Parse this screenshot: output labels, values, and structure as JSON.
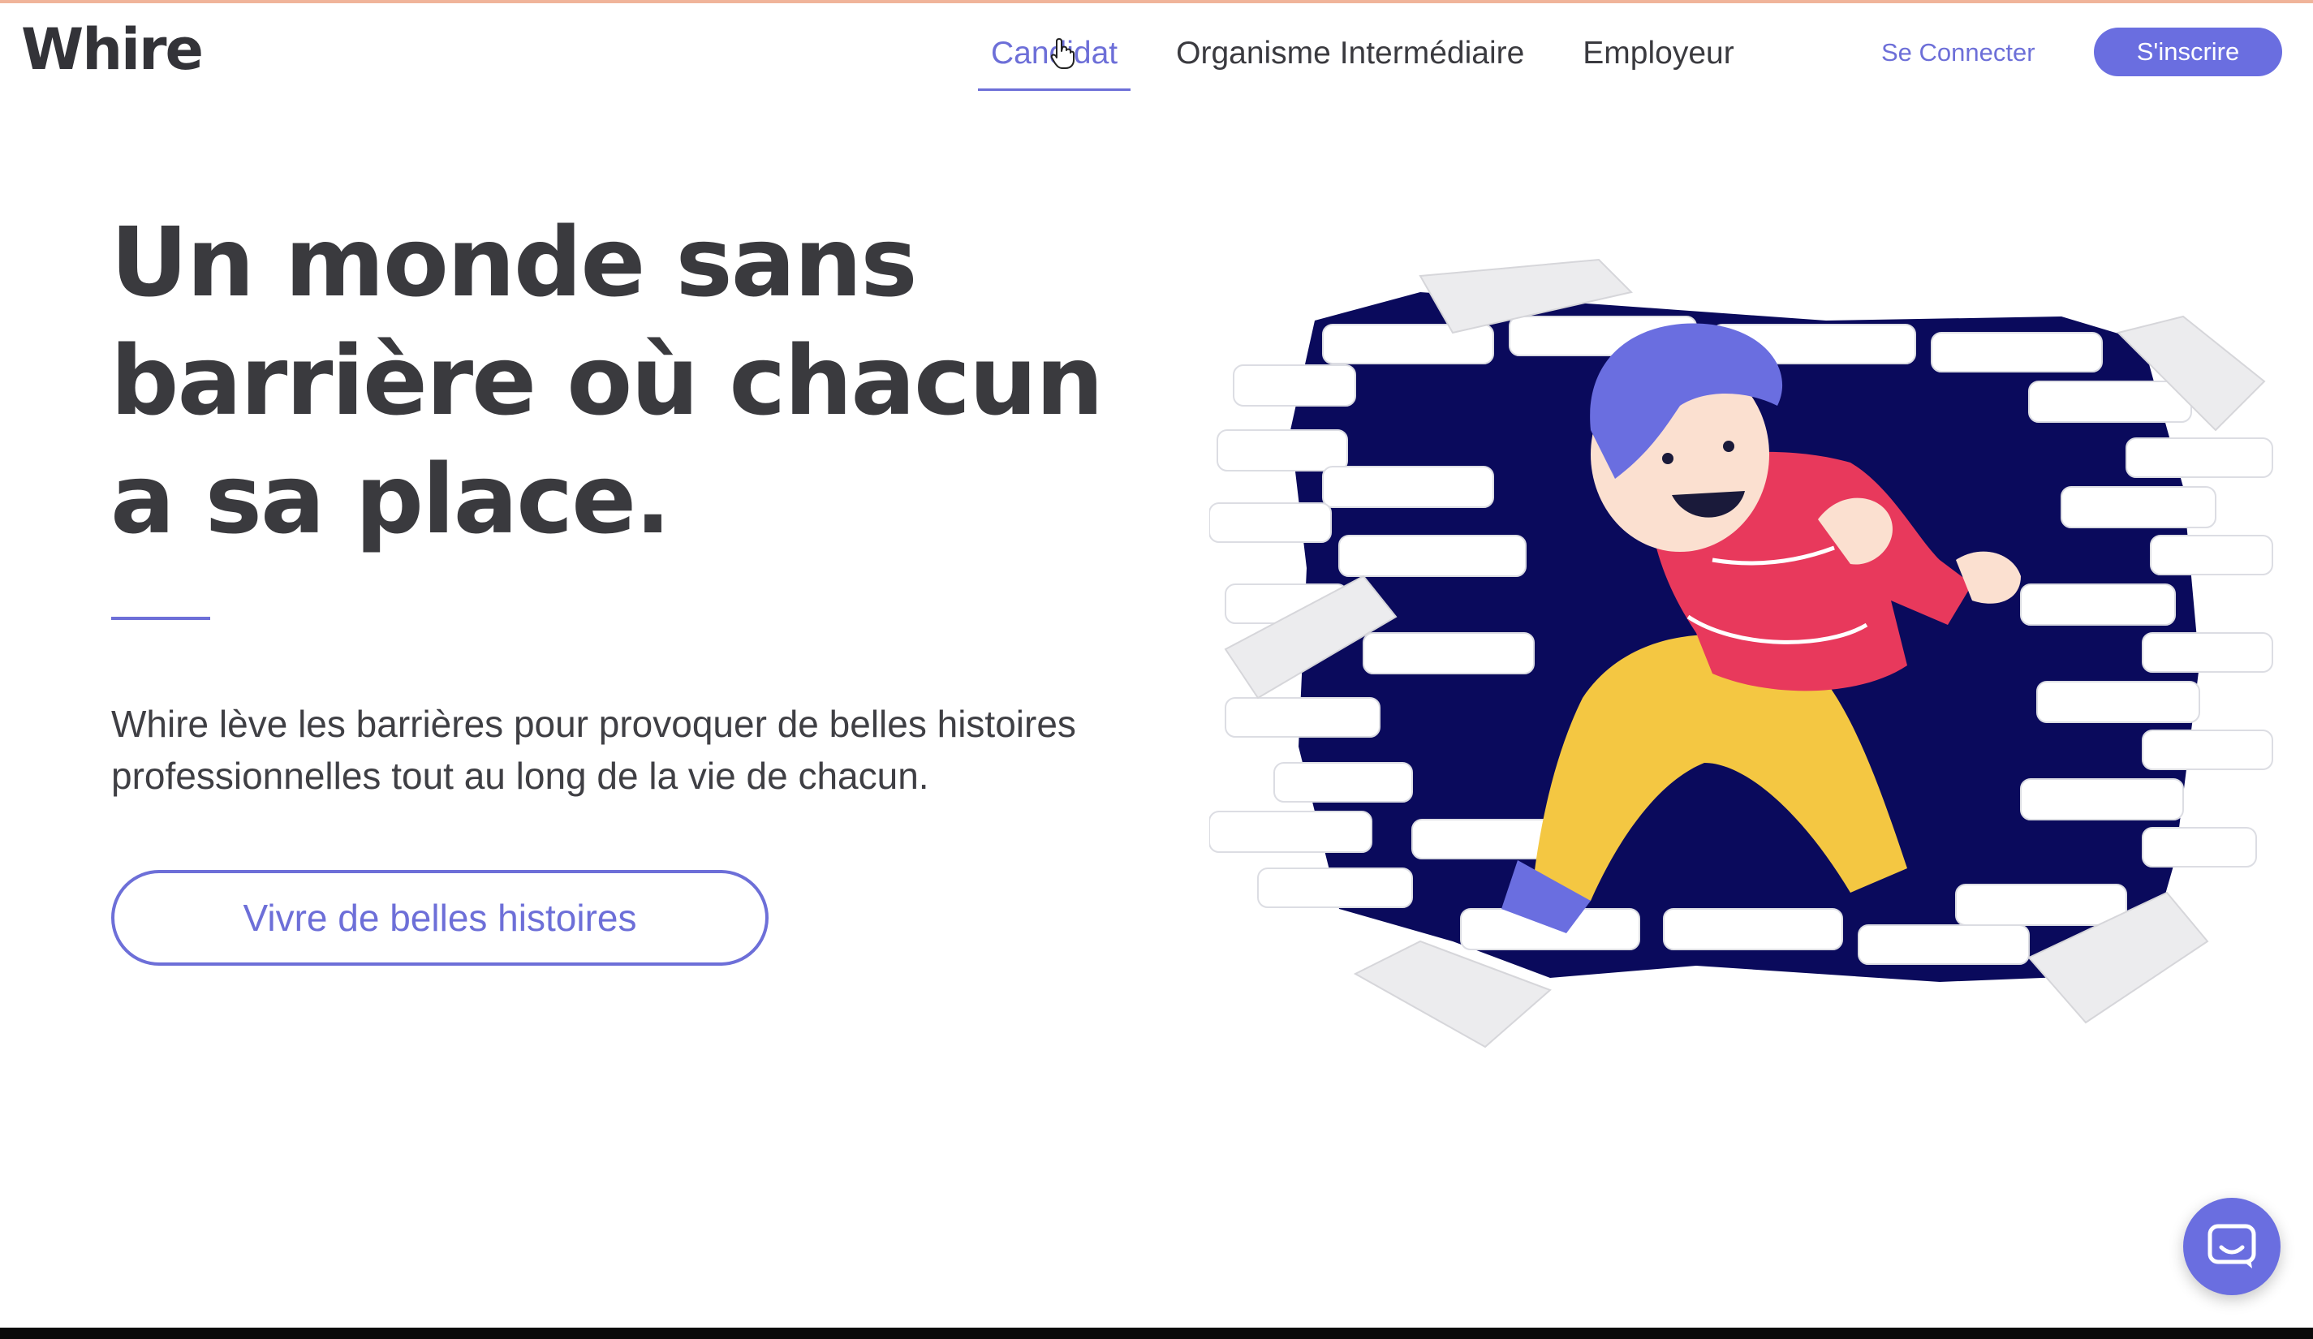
{
  "brand": {
    "logo_text": "Whire",
    "accent_color": "#6d6fd8",
    "button_color": "#6a6ee0",
    "text_color": "#3a3a3e"
  },
  "nav": {
    "items": [
      {
        "label": "Candidat",
        "active": true
      },
      {
        "label": "Organisme Intermédiaire",
        "active": false
      },
      {
        "label": "Employeur",
        "active": false
      }
    ]
  },
  "auth": {
    "login_label": "Se Connecter",
    "signup_label": "S'inscrire"
  },
  "hero": {
    "title_lines": [
      "Un monde sans",
      "barrière où chacun",
      "a sa place."
    ],
    "description_lines": [
      "Whire lève les barrières pour provoquer de belles histoires",
      "professionnelles tout au long de la vie de chacun."
    ],
    "cta_label": "Vivre de belles histoires"
  },
  "icons": {
    "cursor": "hand-pointer-icon",
    "chat": "chat-bubble-icon",
    "illustration": "person-breaking-wall-illustration"
  }
}
